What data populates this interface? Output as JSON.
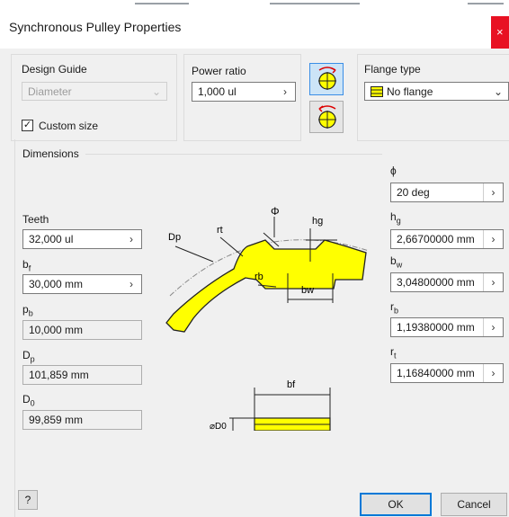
{
  "window": {
    "title": "Synchronous Pulley Properties",
    "close_glyph": "×"
  },
  "design_guide": {
    "label": "Design Guide",
    "value": "Diameter",
    "custom_size_label": "Custom size",
    "custom_size_checked": true
  },
  "power_ratio": {
    "label": "Power ratio",
    "value": "1,000 ul"
  },
  "flange": {
    "label": "Flange type",
    "value": "No flange"
  },
  "dimensions": {
    "label": "Dimensions",
    "left": {
      "teeth": {
        "label": "Teeth",
        "value": "32,000 ul"
      },
      "bf": {
        "label_main": "b",
        "label_sub": "f",
        "value": "30,000 mm"
      },
      "pb": {
        "label_main": "p",
        "label_sub": "b",
        "value": "10,000 mm"
      },
      "dp": {
        "label_main": "D",
        "label_sub": "p",
        "value": "101,859 mm"
      },
      "d0": {
        "label_main": "D",
        "label_sub": "0",
        "value": "99,859 mm"
      }
    },
    "right": {
      "phi": {
        "label": "ϕ",
        "value": "20 deg"
      },
      "hg": {
        "label_main": "h",
        "label_sub": "g",
        "value": "2,66700000 mm"
      },
      "bw": {
        "label_main": "b",
        "label_sub": "w",
        "value": "3,04800000 mm"
      },
      "rb": {
        "label_main": "r",
        "label_sub": "b",
        "value": "1,19380000 mm"
      },
      "rt": {
        "label_main": "r",
        "label_sub": "t",
        "value": "1,16840000 mm"
      }
    },
    "diagram": {
      "labels": {
        "phi": "Φ",
        "hg": "hg",
        "dp": "Dp",
        "rt": "rt",
        "rb": "rb",
        "bw": "bw",
        "bf": "bf",
        "d0": "⌀D0"
      },
      "fill_color": "#ffff00"
    }
  },
  "buttons": {
    "ok": "OK",
    "cancel": "Cancel",
    "help_glyph": "?"
  },
  "colors": {
    "accent": "#0078d7",
    "close": "#e81123",
    "active_icon_bg": "#cce4f7"
  }
}
